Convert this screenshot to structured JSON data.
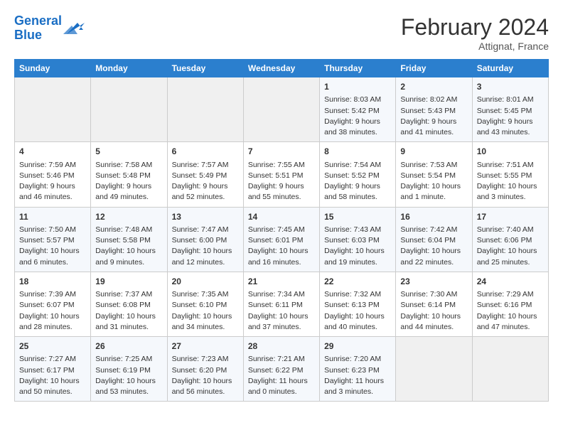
{
  "header": {
    "logo_line1": "General",
    "logo_line2": "Blue",
    "month": "February 2024",
    "location": "Attignat, France"
  },
  "days_of_week": [
    "Sunday",
    "Monday",
    "Tuesday",
    "Wednesday",
    "Thursday",
    "Friday",
    "Saturday"
  ],
  "weeks": [
    [
      {
        "num": "",
        "sunrise": "",
        "sunset": "",
        "daylight": "",
        "empty": true
      },
      {
        "num": "",
        "sunrise": "",
        "sunset": "",
        "daylight": "",
        "empty": true
      },
      {
        "num": "",
        "sunrise": "",
        "sunset": "",
        "daylight": "",
        "empty": true
      },
      {
        "num": "",
        "sunrise": "",
        "sunset": "",
        "daylight": "",
        "empty": true
      },
      {
        "num": "1",
        "sunrise": "Sunrise: 8:03 AM",
        "sunset": "Sunset: 5:42 PM",
        "daylight": "Daylight: 9 hours and 38 minutes.",
        "empty": false
      },
      {
        "num": "2",
        "sunrise": "Sunrise: 8:02 AM",
        "sunset": "Sunset: 5:43 PM",
        "daylight": "Daylight: 9 hours and 41 minutes.",
        "empty": false
      },
      {
        "num": "3",
        "sunrise": "Sunrise: 8:01 AM",
        "sunset": "Sunset: 5:45 PM",
        "daylight": "Daylight: 9 hours and 43 minutes.",
        "empty": false
      }
    ],
    [
      {
        "num": "4",
        "sunrise": "Sunrise: 7:59 AM",
        "sunset": "Sunset: 5:46 PM",
        "daylight": "Daylight: 9 hours and 46 minutes.",
        "empty": false
      },
      {
        "num": "5",
        "sunrise": "Sunrise: 7:58 AM",
        "sunset": "Sunset: 5:48 PM",
        "daylight": "Daylight: 9 hours and 49 minutes.",
        "empty": false
      },
      {
        "num": "6",
        "sunrise": "Sunrise: 7:57 AM",
        "sunset": "Sunset: 5:49 PM",
        "daylight": "Daylight: 9 hours and 52 minutes.",
        "empty": false
      },
      {
        "num": "7",
        "sunrise": "Sunrise: 7:55 AM",
        "sunset": "Sunset: 5:51 PM",
        "daylight": "Daylight: 9 hours and 55 minutes.",
        "empty": false
      },
      {
        "num": "8",
        "sunrise": "Sunrise: 7:54 AM",
        "sunset": "Sunset: 5:52 PM",
        "daylight": "Daylight: 9 hours and 58 minutes.",
        "empty": false
      },
      {
        "num": "9",
        "sunrise": "Sunrise: 7:53 AM",
        "sunset": "Sunset: 5:54 PM",
        "daylight": "Daylight: 10 hours and 1 minute.",
        "empty": false
      },
      {
        "num": "10",
        "sunrise": "Sunrise: 7:51 AM",
        "sunset": "Sunset: 5:55 PM",
        "daylight": "Daylight: 10 hours and 3 minutes.",
        "empty": false
      }
    ],
    [
      {
        "num": "11",
        "sunrise": "Sunrise: 7:50 AM",
        "sunset": "Sunset: 5:57 PM",
        "daylight": "Daylight: 10 hours and 6 minutes.",
        "empty": false
      },
      {
        "num": "12",
        "sunrise": "Sunrise: 7:48 AM",
        "sunset": "Sunset: 5:58 PM",
        "daylight": "Daylight: 10 hours and 9 minutes.",
        "empty": false
      },
      {
        "num": "13",
        "sunrise": "Sunrise: 7:47 AM",
        "sunset": "Sunset: 6:00 PM",
        "daylight": "Daylight: 10 hours and 12 minutes.",
        "empty": false
      },
      {
        "num": "14",
        "sunrise": "Sunrise: 7:45 AM",
        "sunset": "Sunset: 6:01 PM",
        "daylight": "Daylight: 10 hours and 16 minutes.",
        "empty": false
      },
      {
        "num": "15",
        "sunrise": "Sunrise: 7:43 AM",
        "sunset": "Sunset: 6:03 PM",
        "daylight": "Daylight: 10 hours and 19 minutes.",
        "empty": false
      },
      {
        "num": "16",
        "sunrise": "Sunrise: 7:42 AM",
        "sunset": "Sunset: 6:04 PM",
        "daylight": "Daylight: 10 hours and 22 minutes.",
        "empty": false
      },
      {
        "num": "17",
        "sunrise": "Sunrise: 7:40 AM",
        "sunset": "Sunset: 6:06 PM",
        "daylight": "Daylight: 10 hours and 25 minutes.",
        "empty": false
      }
    ],
    [
      {
        "num": "18",
        "sunrise": "Sunrise: 7:39 AM",
        "sunset": "Sunset: 6:07 PM",
        "daylight": "Daylight: 10 hours and 28 minutes.",
        "empty": false
      },
      {
        "num": "19",
        "sunrise": "Sunrise: 7:37 AM",
        "sunset": "Sunset: 6:08 PM",
        "daylight": "Daylight: 10 hours and 31 minutes.",
        "empty": false
      },
      {
        "num": "20",
        "sunrise": "Sunrise: 7:35 AM",
        "sunset": "Sunset: 6:10 PM",
        "daylight": "Daylight: 10 hours and 34 minutes.",
        "empty": false
      },
      {
        "num": "21",
        "sunrise": "Sunrise: 7:34 AM",
        "sunset": "Sunset: 6:11 PM",
        "daylight": "Daylight: 10 hours and 37 minutes.",
        "empty": false
      },
      {
        "num": "22",
        "sunrise": "Sunrise: 7:32 AM",
        "sunset": "Sunset: 6:13 PM",
        "daylight": "Daylight: 10 hours and 40 minutes.",
        "empty": false
      },
      {
        "num": "23",
        "sunrise": "Sunrise: 7:30 AM",
        "sunset": "Sunset: 6:14 PM",
        "daylight": "Daylight: 10 hours and 44 minutes.",
        "empty": false
      },
      {
        "num": "24",
        "sunrise": "Sunrise: 7:29 AM",
        "sunset": "Sunset: 6:16 PM",
        "daylight": "Daylight: 10 hours and 47 minutes.",
        "empty": false
      }
    ],
    [
      {
        "num": "25",
        "sunrise": "Sunrise: 7:27 AM",
        "sunset": "Sunset: 6:17 PM",
        "daylight": "Daylight: 10 hours and 50 minutes.",
        "empty": false
      },
      {
        "num": "26",
        "sunrise": "Sunrise: 7:25 AM",
        "sunset": "Sunset: 6:19 PM",
        "daylight": "Daylight: 10 hours and 53 minutes.",
        "empty": false
      },
      {
        "num": "27",
        "sunrise": "Sunrise: 7:23 AM",
        "sunset": "Sunset: 6:20 PM",
        "daylight": "Daylight: 10 hours and 56 minutes.",
        "empty": false
      },
      {
        "num": "28",
        "sunrise": "Sunrise: 7:21 AM",
        "sunset": "Sunset: 6:22 PM",
        "daylight": "Daylight: 11 hours and 0 minutes.",
        "empty": false
      },
      {
        "num": "29",
        "sunrise": "Sunrise: 7:20 AM",
        "sunset": "Sunset: 6:23 PM",
        "daylight": "Daylight: 11 hours and 3 minutes.",
        "empty": false
      },
      {
        "num": "",
        "sunrise": "",
        "sunset": "",
        "daylight": "",
        "empty": true
      },
      {
        "num": "",
        "sunrise": "",
        "sunset": "",
        "daylight": "",
        "empty": true
      }
    ]
  ]
}
